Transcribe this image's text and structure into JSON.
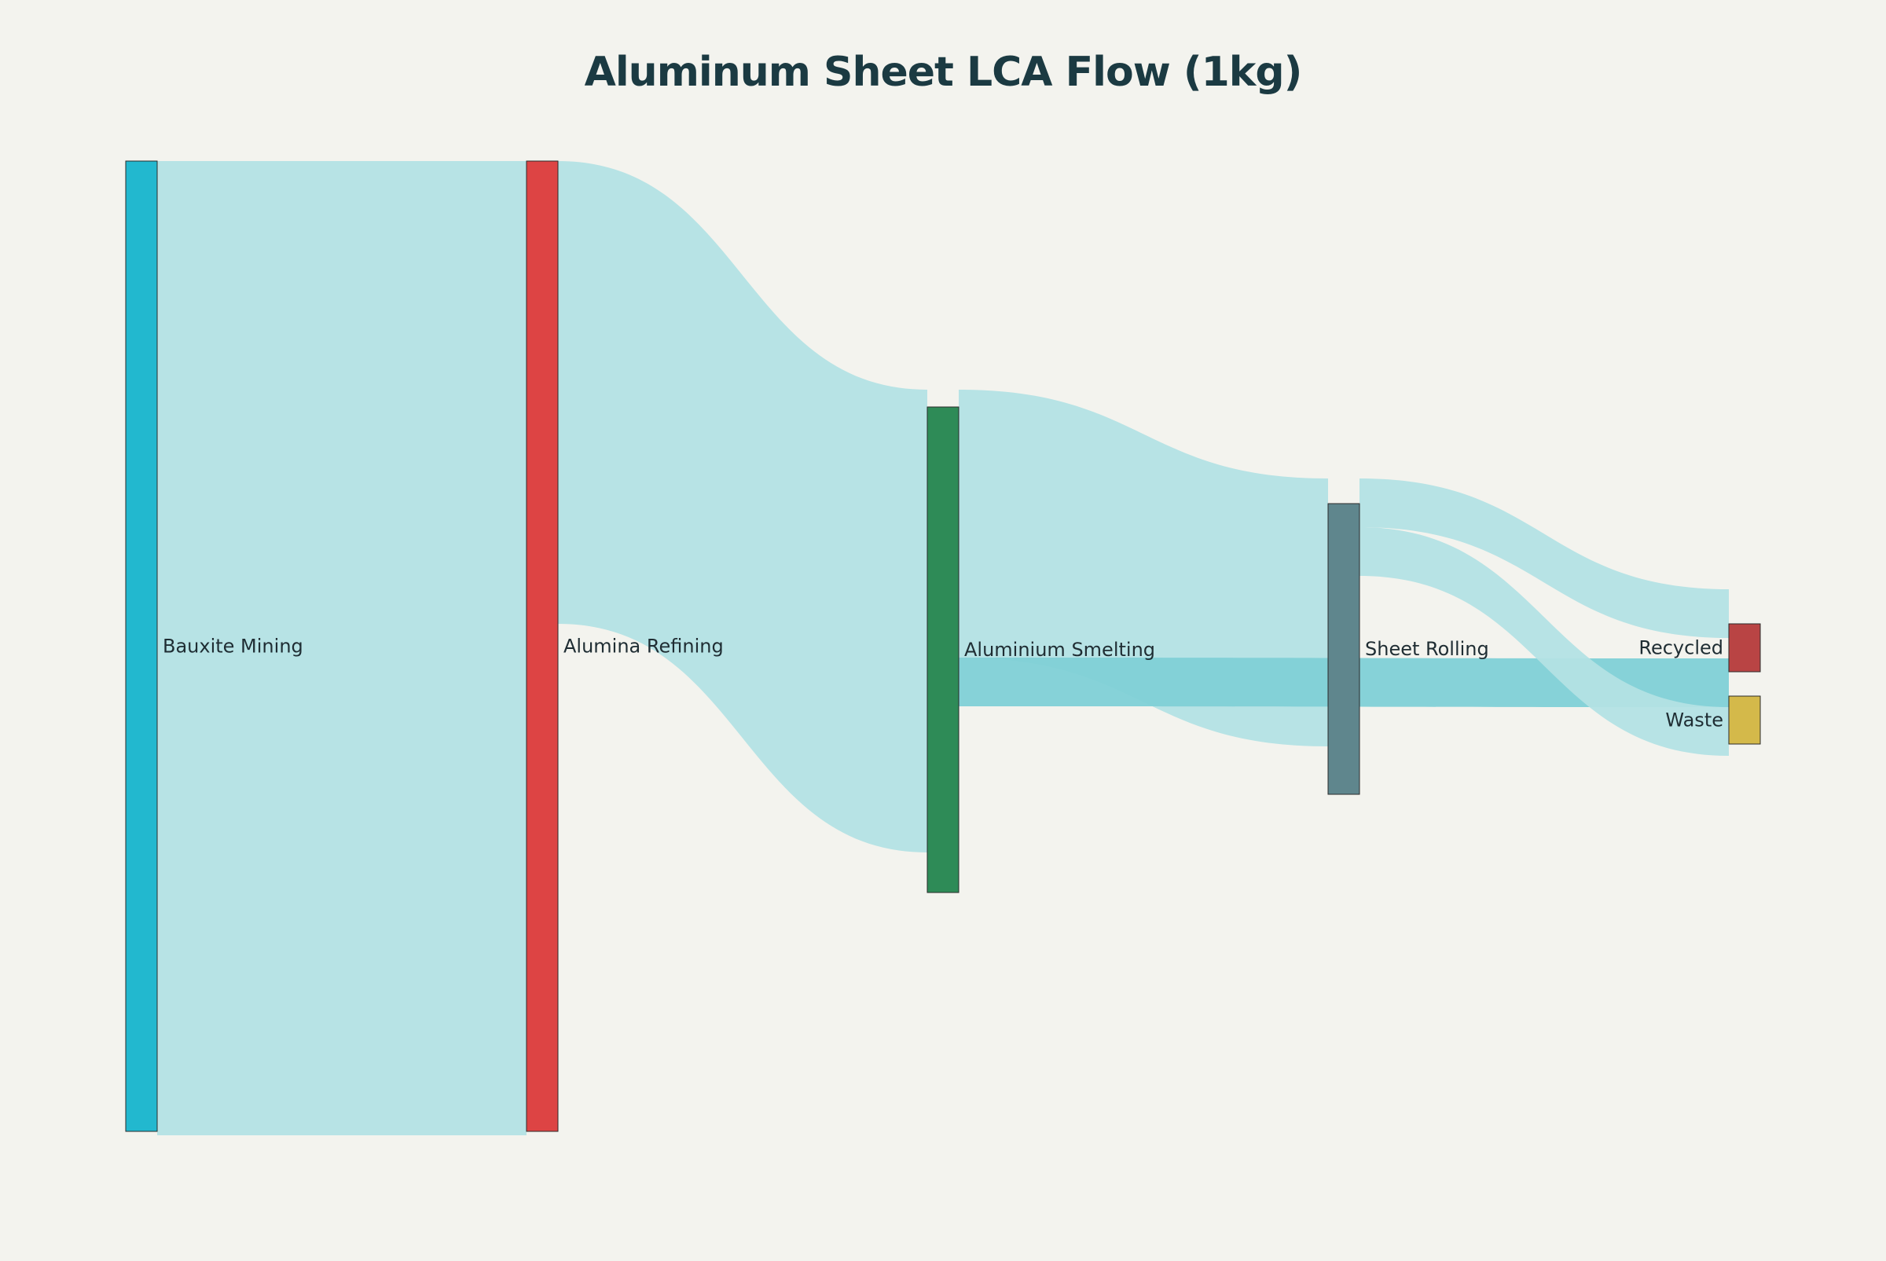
{
  "title": "Aluminum Sheet LCA Flow (1kg)",
  "chart_data": {
    "type": "sankey",
    "title": "Aluminum Sheet LCA Flow (1kg)",
    "nodes": [
      {
        "id": "bauxite",
        "label": "Bauxite Mining",
        "color": "#22b8cf",
        "column": 0
      },
      {
        "id": "alumina",
        "label": "Alumina Refining",
        "color": "#dd4444",
        "column": 1
      },
      {
        "id": "smelting",
        "label": "Aluminium Smelting",
        "color": "#2e8b57",
        "column": 2
      },
      {
        "id": "rolling",
        "label": "Sheet Rolling",
        "color": "#5f868d",
        "column": 3
      },
      {
        "id": "recycled",
        "label": "Recycled",
        "color": "#b94444",
        "column": 4
      },
      {
        "id": "waste",
        "label": "Waste",
        "color": "#d4b94a",
        "column": 4
      }
    ],
    "links": [
      {
        "source": "bauxite",
        "target": "alumina",
        "value": 4.0
      },
      {
        "source": "alumina",
        "target": "smelting",
        "value": 1.9
      },
      {
        "source": "smelting",
        "target": "rolling",
        "value": 1.1
      },
      {
        "source": "smelting",
        "target": "waste",
        "value": 0.2
      },
      {
        "source": "rolling",
        "target": "recycled",
        "value": 0.2
      },
      {
        "source": "rolling",
        "target": "waste",
        "value": 0.2
      }
    ],
    "link_color": "#b3e2e4",
    "link_highlight_color": "#7fd0d6"
  }
}
